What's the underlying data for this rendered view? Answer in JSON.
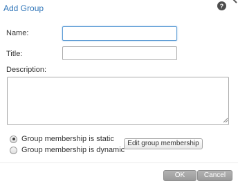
{
  "dialog": {
    "title": "Add Group",
    "help_icon": "help-icon",
    "title_color": "#2e74b8"
  },
  "form": {
    "name_label": "Name:",
    "name_value": "",
    "title_label": "Title:",
    "title_value": "",
    "description_label": "Description:",
    "description_value": ""
  },
  "membership": {
    "options": [
      {
        "label": "Group membership is static",
        "selected": true
      },
      {
        "label": "Group membership is dynamic",
        "selected": false
      }
    ],
    "edit_button_label": "Edit group membership"
  },
  "footer": {
    "ok_label": "OK",
    "cancel_label": "Cancel",
    "button_color": "#a8a8a8"
  }
}
